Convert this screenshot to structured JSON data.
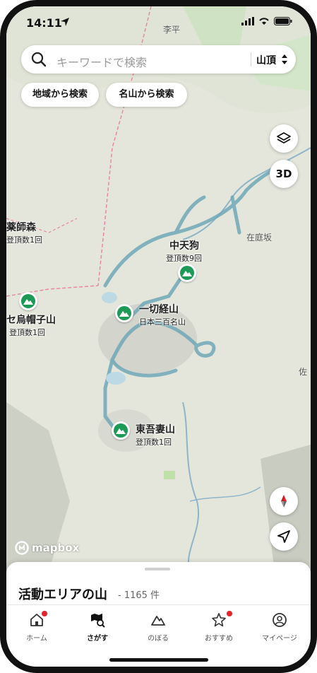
{
  "status_bar": {
    "time": "14:11"
  },
  "search": {
    "placeholder": "キーワードで検索",
    "type_select": "山頂"
  },
  "chips": [
    "地域から検索",
    "名山から検索"
  ],
  "map_controls": {
    "three_d_label": "3D"
  },
  "mountains": [
    {
      "name": "中天狗",
      "sub": "登頂数9回"
    },
    {
      "name": "一切経山",
      "sub": "日本三百名山"
    },
    {
      "name": "東吾妻山",
      "sub": "登頂数1回"
    },
    {
      "name": "セ烏帽子山",
      "sub": "登頂数1回"
    },
    {
      "name": "薬師森",
      "sub": "登頂数1回"
    }
  ],
  "places": [
    "李平",
    "在庭坂",
    "佐"
  ],
  "attribution": "mapbox",
  "sheet": {
    "title": "活動エリアの山",
    "count": "- 1165 件"
  },
  "tabs": [
    {
      "label": "ホーム",
      "icon": "home-icon",
      "badge": true
    },
    {
      "label": "さがす",
      "icon": "map-search-icon",
      "badge": false,
      "active": true
    },
    {
      "label": "のぼる",
      "icon": "mountain-icon",
      "badge": false
    },
    {
      "label": "おすすめ",
      "icon": "star-icon",
      "badge": true
    },
    {
      "label": "マイページ",
      "icon": "user-icon",
      "badge": false
    }
  ],
  "colors": {
    "accent": "#1d9a55",
    "badge": "#e5232a",
    "track": "#6fa8b8"
  }
}
